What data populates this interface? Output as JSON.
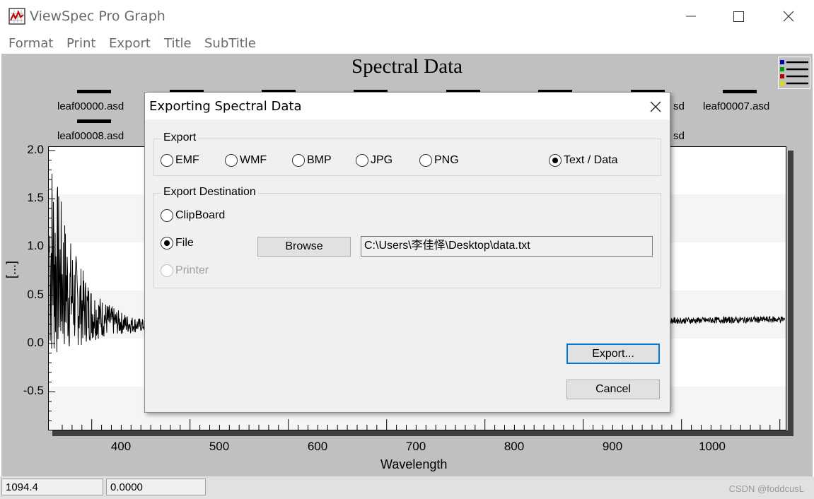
{
  "window": {
    "title": "ViewSpec Pro Graph",
    "icon": "graph-app-icon",
    "controls": [
      "minimize-icon",
      "maximize-icon",
      "close-icon"
    ]
  },
  "menu": {
    "items": [
      "Format",
      "Print",
      "Export",
      "Title",
      "SubTitle"
    ]
  },
  "graph": {
    "title": "Spectral Data",
    "legend_entries": [
      "leaf00000.asd",
      "leaf00007.asd",
      "leaf00008.asd"
    ],
    "legend_partial": [
      "sd",
      "sd"
    ],
    "y_ticks": [
      "2.0",
      "1.5",
      "1.0",
      "0.5",
      "0.0",
      "-0.5"
    ],
    "x_ticks": [
      "400",
      "500",
      "600",
      "700",
      "800",
      "900",
      "1000"
    ],
    "xlabel": "Wavelength",
    "ylabel": "[...]",
    "line_color": "#000000",
    "background": "#c0c0c0"
  },
  "statusbar": {
    "wavelength": "1094.4",
    "value": "0.0000",
    "watermark": "CSDN @foddcusL"
  },
  "dialog": {
    "title": "Exporting Spectral Data",
    "export_group_label": "Export",
    "export_formats": [
      {
        "label": "EMF",
        "checked": false
      },
      {
        "label": "WMF",
        "checked": false
      },
      {
        "label": "BMP",
        "checked": false
      },
      {
        "label": "JPG",
        "checked": false
      },
      {
        "label": "PNG",
        "checked": false
      },
      {
        "label": "Text / Data",
        "checked": true
      }
    ],
    "destination_group_label": "Export Destination",
    "destinations": [
      {
        "label": "ClipBoard",
        "checked": false,
        "disabled": false
      },
      {
        "label": "File",
        "checked": true,
        "disabled": false
      },
      {
        "label": "Printer",
        "checked": false,
        "disabled": true
      }
    ],
    "browse_label": "Browse",
    "file_path": "C:\\Users\\李佳怿\\Desktop\\data.txt",
    "export_button": "Export...",
    "cancel_button": "Cancel"
  }
}
